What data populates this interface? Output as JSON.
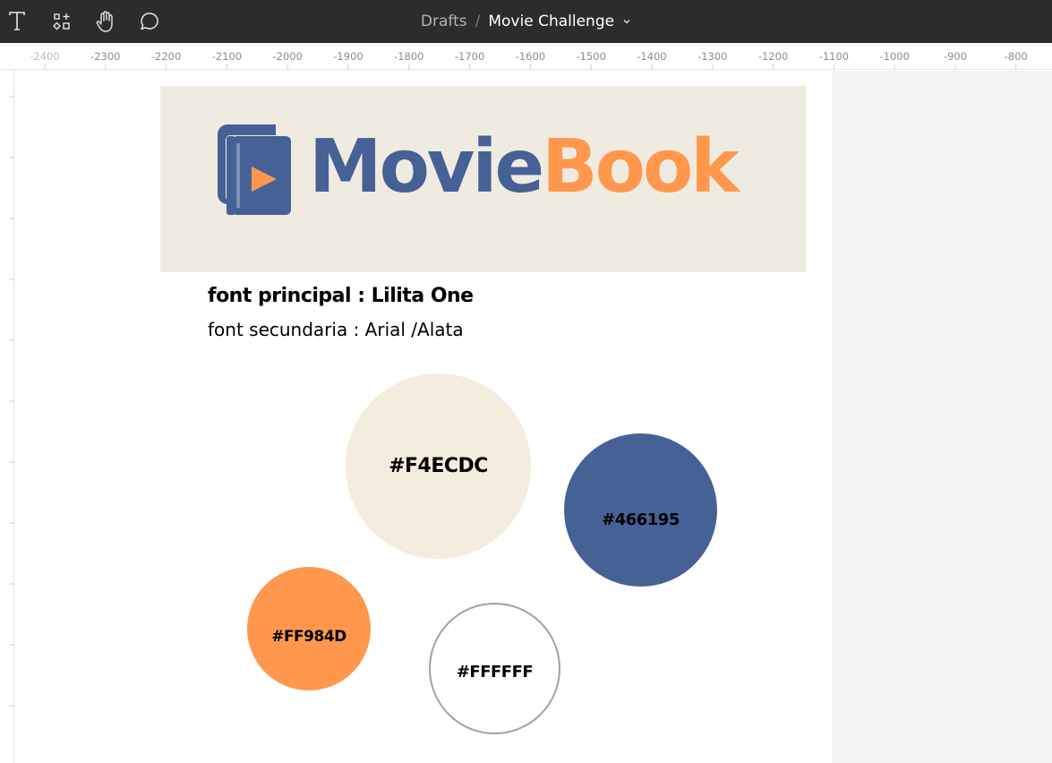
{
  "toolbar": {
    "breadcrumb": {
      "parent": "Drafts",
      "separator": "/",
      "file": "Movie Challenge"
    },
    "tools": [
      {
        "name": "text-tool",
        "icon": "text-icon"
      },
      {
        "name": "resources-tool",
        "icon": "shapes-plus-icon"
      },
      {
        "name": "hand-tool",
        "icon": "hand-icon"
      },
      {
        "name": "comment-tool",
        "icon": "comment-icon"
      }
    ]
  },
  "ruler": {
    "labels": [
      "-2400",
      "-2300",
      "-2200",
      "-2100",
      "-2000",
      "-1900",
      "-1800",
      "-1700",
      "-1600",
      "-1500",
      "-1400",
      "-1300",
      "-1200",
      "-1100",
      "-1000",
      "-900",
      "-800"
    ]
  },
  "logo": {
    "word1": "Movie",
    "word2": "Book"
  },
  "fonts": {
    "primary": "font principal : Lilita One",
    "secondary": "font secundaria : Arial /Alata"
  },
  "palette": {
    "beige": "#F4ECDC",
    "blue": "#466195",
    "orange": "#FF984D",
    "white": "#FFFFFF"
  },
  "colors": {
    "toolbar_bg": "#2c2c2c",
    "banner_bg": "#f0ebe1",
    "canvas_gray": "#f4f4f4"
  }
}
